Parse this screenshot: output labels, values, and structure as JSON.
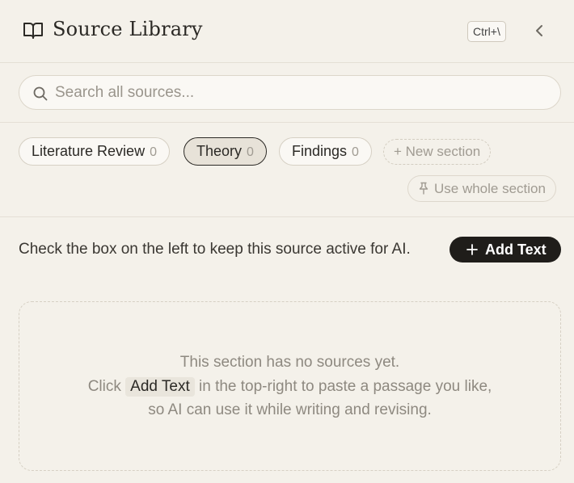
{
  "header": {
    "title": "Source Library",
    "shortcut": "Ctrl+\\",
    "icon": "book-open-icon",
    "collapse_icon": "chevron-left-icon"
  },
  "search": {
    "placeholder": "Search all sources...",
    "value": ""
  },
  "sections": {
    "tabs": [
      {
        "label": "Literature Review",
        "count": "0",
        "active": false
      },
      {
        "label": "Theory",
        "count": "0",
        "active": true
      },
      {
        "label": "Findings",
        "count": "0",
        "active": false
      }
    ],
    "new_section_label": "+ New section",
    "use_whole_section_label": "Use whole section"
  },
  "main": {
    "hint": "Check the box on the left to keep this source active for AI.",
    "add_text_label": "Add Text"
  },
  "empty_state": {
    "line1": "This section has no sources yet.",
    "line2_before": "Click",
    "line2_chip": "Add Text",
    "line2_after": "in the top-right to paste a passage you like,",
    "line3": "so AI can use it while writing and revising."
  },
  "colors": {
    "background": "#f4f1ea",
    "accent": "#1f1d1a",
    "border": "#e4dfd5"
  }
}
